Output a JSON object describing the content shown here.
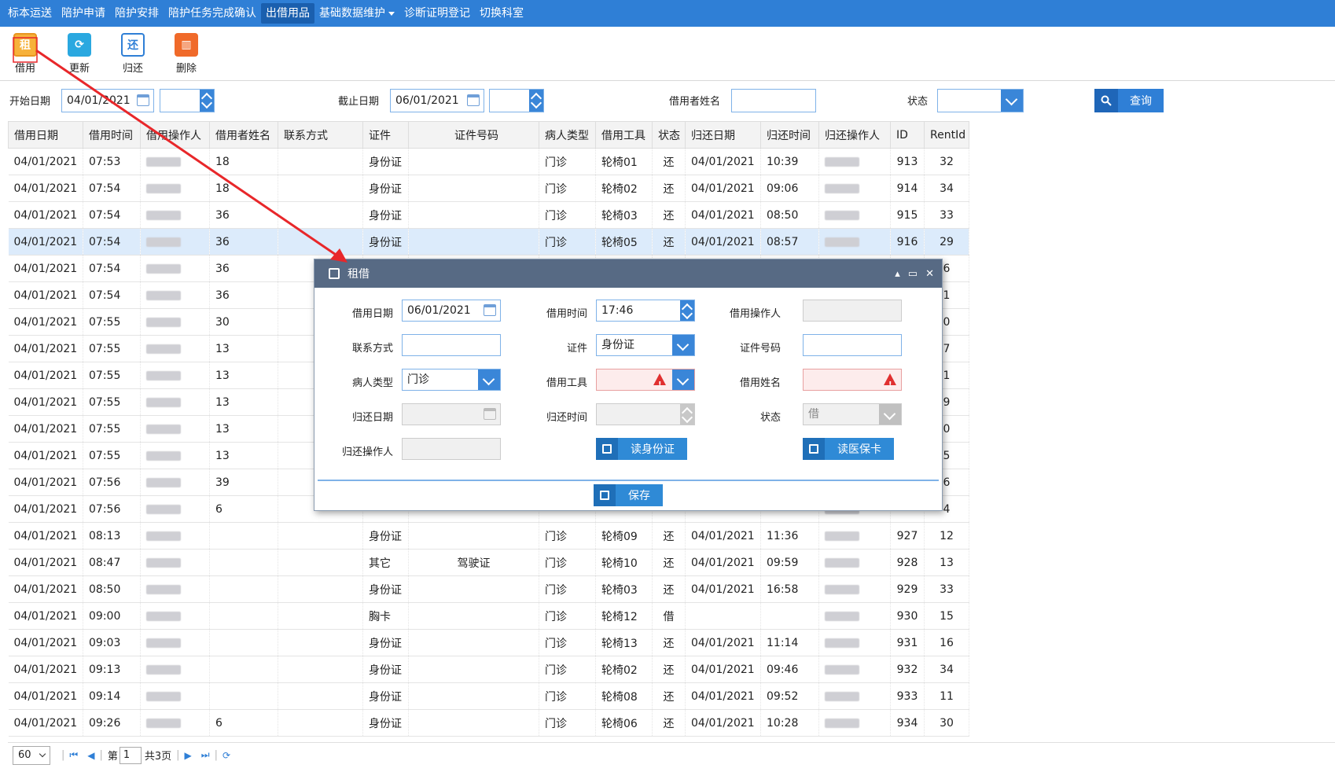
{
  "nav": {
    "items": [
      "标本运送",
      "陪护申请",
      "陪护安排",
      "陪护任务完成确认",
      "出借用品",
      "基础数据维护",
      "诊断证明登记",
      "切换科室"
    ],
    "active_index": 4
  },
  "toolbar": {
    "borrow": {
      "label": "借用",
      "icon": "租",
      "color": "#f0a030"
    },
    "refresh": {
      "label": "更新",
      "icon": "refresh-icon",
      "color": "#2aa8e0"
    },
    "return": {
      "label": "归还",
      "icon": "还",
      "color": "#2f7fd6"
    },
    "delete": {
      "label": "删除",
      "icon": "trash-icon",
      "color": "#f06a2a"
    }
  },
  "filter": {
    "start_date_label": "开始日期",
    "start_date": "04/01/2021",
    "end_date_label": "截止日期",
    "end_date": "06/01/2021",
    "borrower_label": "借用者姓名",
    "borrower_value": "",
    "status_label": "状态",
    "status_value": "",
    "query_label": "查询"
  },
  "table": {
    "columns": [
      "借用日期",
      "借用时间",
      "借用操作人",
      "借用者姓名",
      "联系方式",
      "证件",
      "证件号码",
      "病人类型",
      "借用工具",
      "状态",
      "归还日期",
      "归还时间",
      "归还操作人",
      "ID",
      "RentId"
    ],
    "rows": [
      [
        "04/01/2021",
        "07:53",
        "",
        "18",
        "",
        "身份证",
        "",
        "门诊",
        "轮椅01",
        "还",
        "04/01/2021",
        "10:39",
        "",
        "913",
        "32"
      ],
      [
        "04/01/2021",
        "07:54",
        "",
        "18",
        "",
        "身份证",
        "",
        "门诊",
        "轮椅02",
        "还",
        "04/01/2021",
        "09:06",
        "",
        "914",
        "34"
      ],
      [
        "04/01/2021",
        "07:54",
        "",
        "36",
        "",
        "身份证",
        "",
        "门诊",
        "轮椅03",
        "还",
        "04/01/2021",
        "08:50",
        "",
        "915",
        "33"
      ],
      [
        "04/01/2021",
        "07:54",
        "",
        "36",
        "",
        "身份证",
        "",
        "门诊",
        "轮椅05",
        "还",
        "04/01/2021",
        "08:57",
        "",
        "916",
        "29"
      ],
      [
        "04/01/2021",
        "07:54",
        "",
        "36",
        "",
        "",
        "",
        "",
        "",
        "",
        "",
        "",
        "",
        "",
        "6"
      ],
      [
        "04/01/2021",
        "07:54",
        "",
        "36",
        "",
        "",
        "",
        "",
        "",
        "",
        "",
        "",
        "",
        "",
        "1"
      ],
      [
        "04/01/2021",
        "07:55",
        "",
        "30",
        "",
        "",
        "",
        "",
        "",
        "",
        "",
        "",
        "",
        "",
        "0"
      ],
      [
        "04/01/2021",
        "07:55",
        "",
        "13",
        "",
        "",
        "",
        "",
        "",
        "",
        "",
        "",
        "",
        "",
        "7"
      ],
      [
        "04/01/2021",
        "07:55",
        "",
        "13",
        "",
        "",
        "",
        "",
        "",
        "",
        "",
        "",
        "",
        "",
        "1"
      ],
      [
        "04/01/2021",
        "07:55",
        "",
        "13",
        "",
        "",
        "",
        "",
        "",
        "",
        "",
        "",
        "",
        "",
        "9"
      ],
      [
        "04/01/2021",
        "07:55",
        "",
        "13",
        "",
        "",
        "",
        "",
        "",
        "",
        "",
        "",
        "",
        "",
        "0"
      ],
      [
        "04/01/2021",
        "07:55",
        "",
        "13",
        "",
        "",
        "",
        "",
        "",
        "",
        "",
        "",
        "",
        "",
        "5"
      ],
      [
        "04/01/2021",
        "07:56",
        "",
        "39",
        "",
        "",
        "",
        "",
        "",
        "",
        "",
        "",
        "",
        "",
        "6"
      ],
      [
        "04/01/2021",
        "07:56",
        "",
        "6",
        "",
        "",
        "",
        "",
        "",
        "",
        "",
        "",
        "",
        "",
        "4"
      ],
      [
        "04/01/2021",
        "08:13",
        "",
        "",
        "",
        "身份证",
        "",
        "门诊",
        "轮椅09",
        "还",
        "04/01/2021",
        "11:36",
        "",
        "927",
        "12"
      ],
      [
        "04/01/2021",
        "08:47",
        "",
        "",
        "",
        "其它",
        "驾驶证",
        "门诊",
        "轮椅10",
        "还",
        "04/01/2021",
        "09:59",
        "",
        "928",
        "13"
      ],
      [
        "04/01/2021",
        "08:50",
        "",
        "",
        "",
        "身份证",
        "",
        "门诊",
        "轮椅03",
        "还",
        "04/01/2021",
        "16:58",
        "",
        "929",
        "33"
      ],
      [
        "04/01/2021",
        "09:00",
        "",
        "",
        "",
        "胸卡",
        "",
        "门诊",
        "轮椅12",
        "借",
        "",
        "",
        "",
        "930",
        "15"
      ],
      [
        "04/01/2021",
        "09:03",
        "",
        "",
        "",
        "身份证",
        "",
        "门诊",
        "轮椅13",
        "还",
        "04/01/2021",
        "11:14",
        "",
        "931",
        "16"
      ],
      [
        "04/01/2021",
        "09:13",
        "",
        "",
        "",
        "身份证",
        "",
        "门诊",
        "轮椅02",
        "还",
        "04/01/2021",
        "09:46",
        "",
        "932",
        "34"
      ],
      [
        "04/01/2021",
        "09:14",
        "",
        "",
        "",
        "身份证",
        "",
        "门诊",
        "轮椅08",
        "还",
        "04/01/2021",
        "09:52",
        "",
        "933",
        "11"
      ],
      [
        "04/01/2021",
        "09:26",
        "",
        "6",
        "",
        "身份证",
        "",
        "门诊",
        "轮椅06",
        "还",
        "04/01/2021",
        "10:28",
        "",
        "934",
        "30"
      ]
    ],
    "selected_row": 3
  },
  "pager": {
    "page_size": "60",
    "page_prefix": "第",
    "page_value": "1",
    "page_total": "共3页"
  },
  "dialog": {
    "title": "租借",
    "borrow_date_label": "借用日期",
    "borrow_date": "06/01/2021",
    "borrow_time_label": "借用时间",
    "borrow_time": "17:46",
    "operator_label": "借用操作人",
    "operator_value": "",
    "contact_label": "联系方式",
    "contact_value": "",
    "cert_label": "证件",
    "cert_value": "身份证",
    "cert_no_label": "证件号码",
    "cert_no_value": "",
    "patient_type_label": "病人类型",
    "patient_type_value": "门诊",
    "tool_label": "借用工具",
    "tool_value": "",
    "borrower_label": "借用姓名",
    "borrower_value": "",
    "return_date_label": "归还日期",
    "return_date": "",
    "return_time_label": "归还时间",
    "return_time": "",
    "status_label": "状态",
    "status_value": "借",
    "return_operator_label": "归还操作人",
    "return_operator_value": "",
    "read_id_label": "读身份证",
    "read_card_label": "读医保卡",
    "save_label": "保存"
  },
  "annotation": {
    "arrow_color": "#e8272a"
  }
}
